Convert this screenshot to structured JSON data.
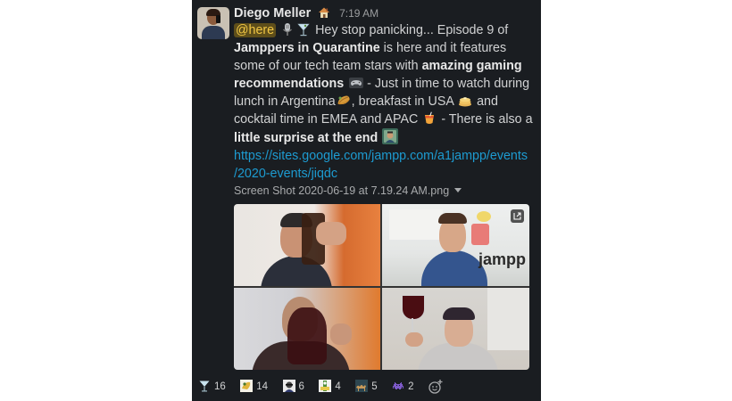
{
  "message": {
    "sender": "Diego Meller",
    "time": "7:19 AM",
    "mention": "@here",
    "text_1": "Hey stop panicking... Episode 9 of",
    "bold_1": "Jamppers in Quarantine",
    "text_2": "is here and it features some of our tech team stars with",
    "bold_2": "amazing gaming recommendations",
    "text_3": "- Just in time to watch during lunch in Argentina",
    "text_4": ", breakfast in USA",
    "text_5": "and cocktail time in EMEA and APAC",
    "text_6": "- There is also a",
    "bold_3": "little surprise at the end",
    "link_line_1": "https://sites.google.com/jampp.com/a1jampp/events",
    "link_line_2": "/2020-events/jiqdc"
  },
  "attachment": {
    "filename": "Screen Shot 2020-06-19 at 7.19.24 AM.png",
    "tile_logo_text": "jampp"
  },
  "reactions": [
    {
      "icon": "cocktail-glass",
      "count": "16"
    },
    {
      "icon": "custom-emoji-1",
      "count": "14"
    },
    {
      "icon": "custom-emoji-2",
      "count": "6"
    },
    {
      "icon": "custom-emoji-3",
      "count": "4"
    },
    {
      "icon": "camel",
      "count": "5"
    },
    {
      "icon": "space-invader",
      "count": "2"
    }
  ],
  "colors": {
    "background": "#1a1d21",
    "link": "#1d9bd1",
    "mention_text": "#f2c744",
    "mention_bg": "#5e4e1a"
  }
}
